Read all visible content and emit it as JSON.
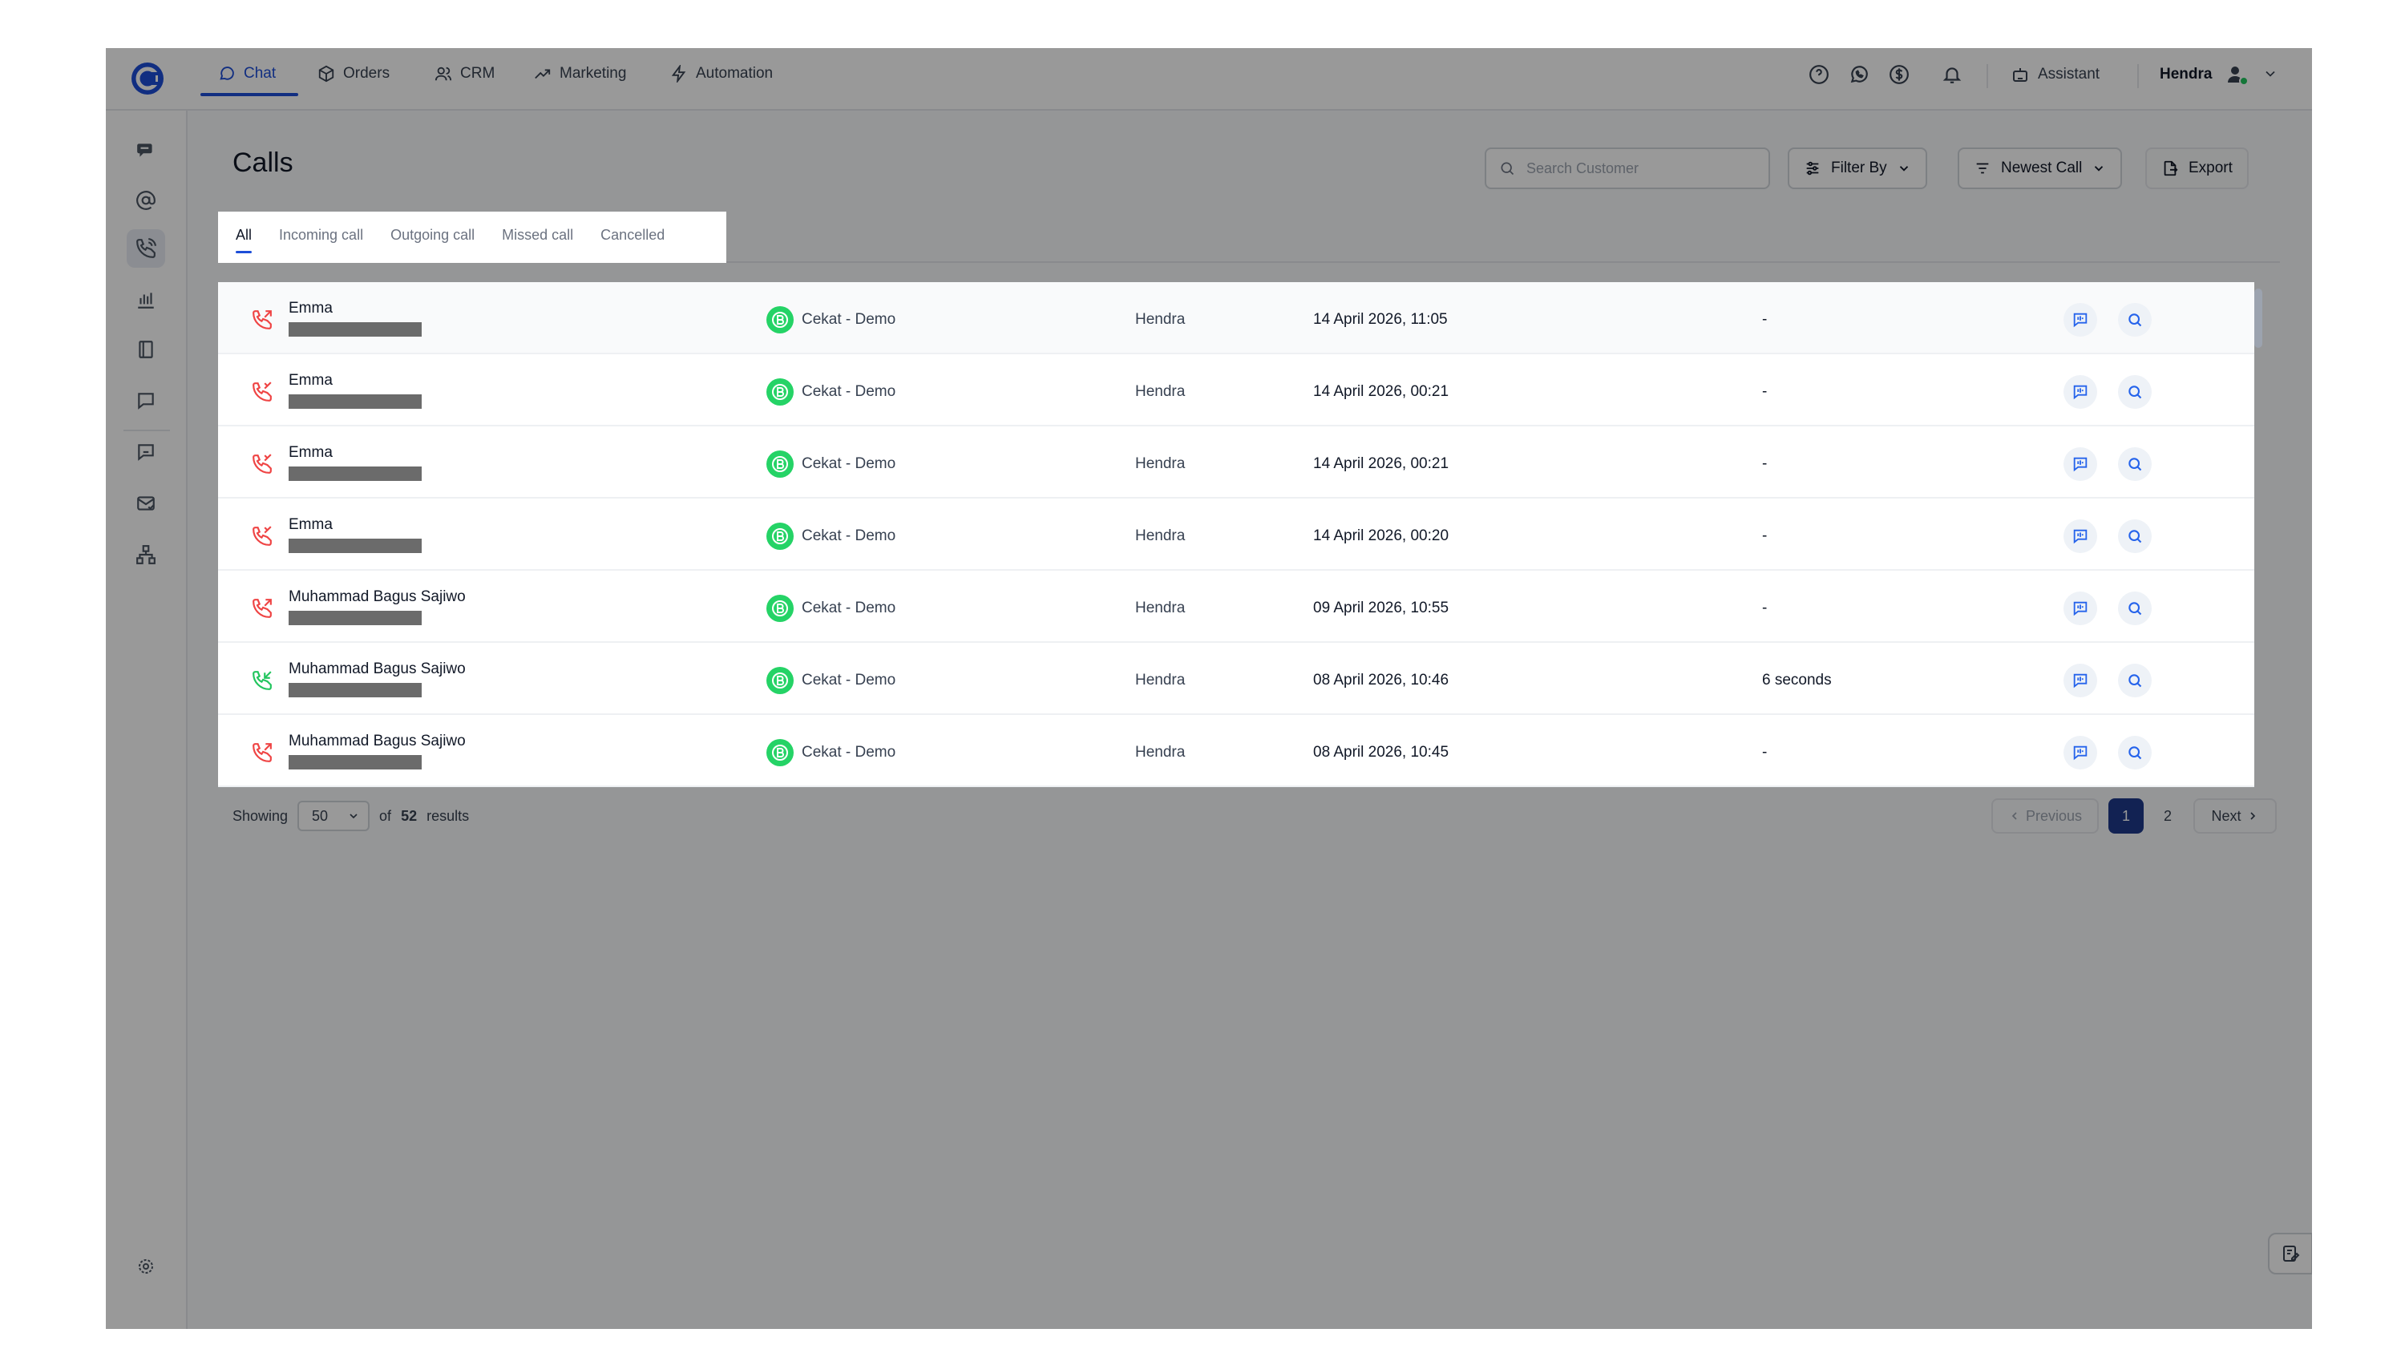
{
  "topnav": {
    "tabs": [
      {
        "label": "Chat"
      },
      {
        "label": "Orders"
      },
      {
        "label": "CRM"
      },
      {
        "label": "Marketing"
      },
      {
        "label": "Automation"
      }
    ],
    "assistant_label": "Assistant",
    "user_name": "Hendra"
  },
  "page": {
    "title": "Calls",
    "search_placeholder": "Search Customer",
    "filter_label": "Filter By",
    "sort_label": "Newest Call",
    "export_label": "Export"
  },
  "tabs": [
    {
      "label": "All",
      "active": true
    },
    {
      "label": "Incoming call"
    },
    {
      "label": "Outgoing call"
    },
    {
      "label": "Missed call"
    },
    {
      "label": "Cancelled"
    }
  ],
  "calls": [
    {
      "name": "Emma",
      "direction": "outgoing",
      "status_color": "#ef4444",
      "channel": "Cekat - Demo",
      "agent": "Hendra",
      "date": "14 April 2026, 11:05",
      "duration": "-"
    },
    {
      "name": "Emma",
      "direction": "missed",
      "status_color": "#ef4444",
      "channel": "Cekat - Demo",
      "agent": "Hendra",
      "date": "14 April 2026, 00:21",
      "duration": "-"
    },
    {
      "name": "Emma",
      "direction": "missed",
      "status_color": "#ef4444",
      "channel": "Cekat - Demo",
      "agent": "Hendra",
      "date": "14 April 2026, 00:21",
      "duration": "-"
    },
    {
      "name": "Emma",
      "direction": "missed",
      "status_color": "#ef4444",
      "channel": "Cekat - Demo",
      "agent": "Hendra",
      "date": "14 April 2026, 00:20",
      "duration": "-"
    },
    {
      "name": "Muhammad Bagus Sajiwo",
      "direction": "outgoing",
      "status_color": "#ef4444",
      "channel": "Cekat - Demo",
      "agent": "Hendra",
      "date": "09 April 2026, 10:55",
      "duration": "-"
    },
    {
      "name": "Muhammad Bagus Sajiwo",
      "direction": "incoming",
      "status_color": "#22c55e",
      "channel": "Cekat - Demo",
      "agent": "Hendra",
      "date": "08 April 2026, 10:46",
      "duration": "6 seconds"
    },
    {
      "name": "Muhammad Bagus Sajiwo",
      "direction": "outgoing",
      "status_color": "#ef4444",
      "channel": "Cekat - Demo",
      "agent": "Hendra",
      "date": "08 April 2026, 10:45",
      "duration": "-"
    }
  ],
  "footer": {
    "showing_label": "Showing",
    "page_size": "50",
    "of_label": "of",
    "total": "52",
    "results_label": "results",
    "previous_label": "Previous",
    "next_label": "Next",
    "pages": [
      "1",
      "2"
    ],
    "current_page": "1"
  },
  "colors": {
    "accent": "#1d4ed8",
    "page_active": "#1e3a8a",
    "whatsapp": "#25d366",
    "missed": "#ef4444",
    "answered": "#22c55e",
    "redaction": "#6b6b6b",
    "online": "#22c55e"
  },
  "icons": {
    "sidebar": [
      "chat-bubbles-icon",
      "at-sign-icon",
      "phone-icon",
      "bar-chart-icon",
      "book-icon",
      "message-square-icon",
      "message-dots-icon",
      "mail-check-icon",
      "network-icon",
      "settings-icon"
    ],
    "topbar": [
      "help-circle-icon",
      "whatsapp-icon",
      "dollar-circle-icon",
      "bell-icon",
      "robot-icon",
      "user-status-icon",
      "chevron-down-icon"
    ],
    "row_actions": [
      "transcript-icon",
      "search-icon"
    ]
  }
}
